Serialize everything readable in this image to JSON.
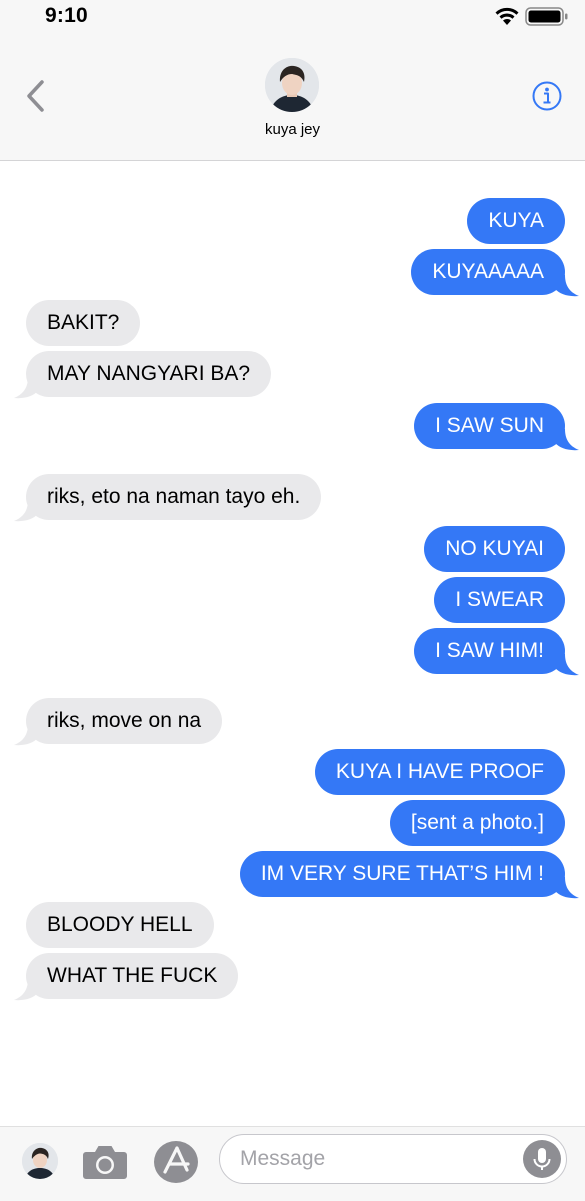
{
  "status_bar": {
    "time": "9:10"
  },
  "header": {
    "contact_name": "kuya jey"
  },
  "messages": [
    {
      "side": "sent",
      "text": "KUYA"
    },
    {
      "side": "sent",
      "text": "KUYAAAAA"
    },
    {
      "side": "received",
      "text": "BAKIT?"
    },
    {
      "side": "received",
      "text": "MAY NANGYARI BA?"
    },
    {
      "side": "sent",
      "text": "I SAW SUN"
    },
    {
      "side": "received",
      "text": "riks, eto na naman tayo eh."
    },
    {
      "side": "sent",
      "text": "NO KUYAI"
    },
    {
      "side": "sent",
      "text": "I SWEAR"
    },
    {
      "side": "sent",
      "text": "I SAW HIM!"
    },
    {
      "side": "received",
      "text": "riks, move on na"
    },
    {
      "side": "sent",
      "text": "KUYA I HAVE PROOF"
    },
    {
      "side": "sent",
      "text": "[sent a photo.]"
    },
    {
      "side": "sent",
      "text": "IM VERY SURE THAT’S HIM !"
    },
    {
      "side": "received",
      "text": "BLOODY HELL"
    },
    {
      "side": "received",
      "text": "WHAT THE FUCK"
    }
  ],
  "composer": {
    "placeholder": "Message"
  },
  "colors": {
    "sent_bubble": "#3478f6",
    "received_bubble": "#e9e9eb",
    "accent": "#3478f6"
  },
  "icons": [
    "wifi-icon",
    "battery-icon",
    "chevron-left-icon",
    "info-icon",
    "camera-icon",
    "app-store-icon",
    "microphone-icon"
  ]
}
